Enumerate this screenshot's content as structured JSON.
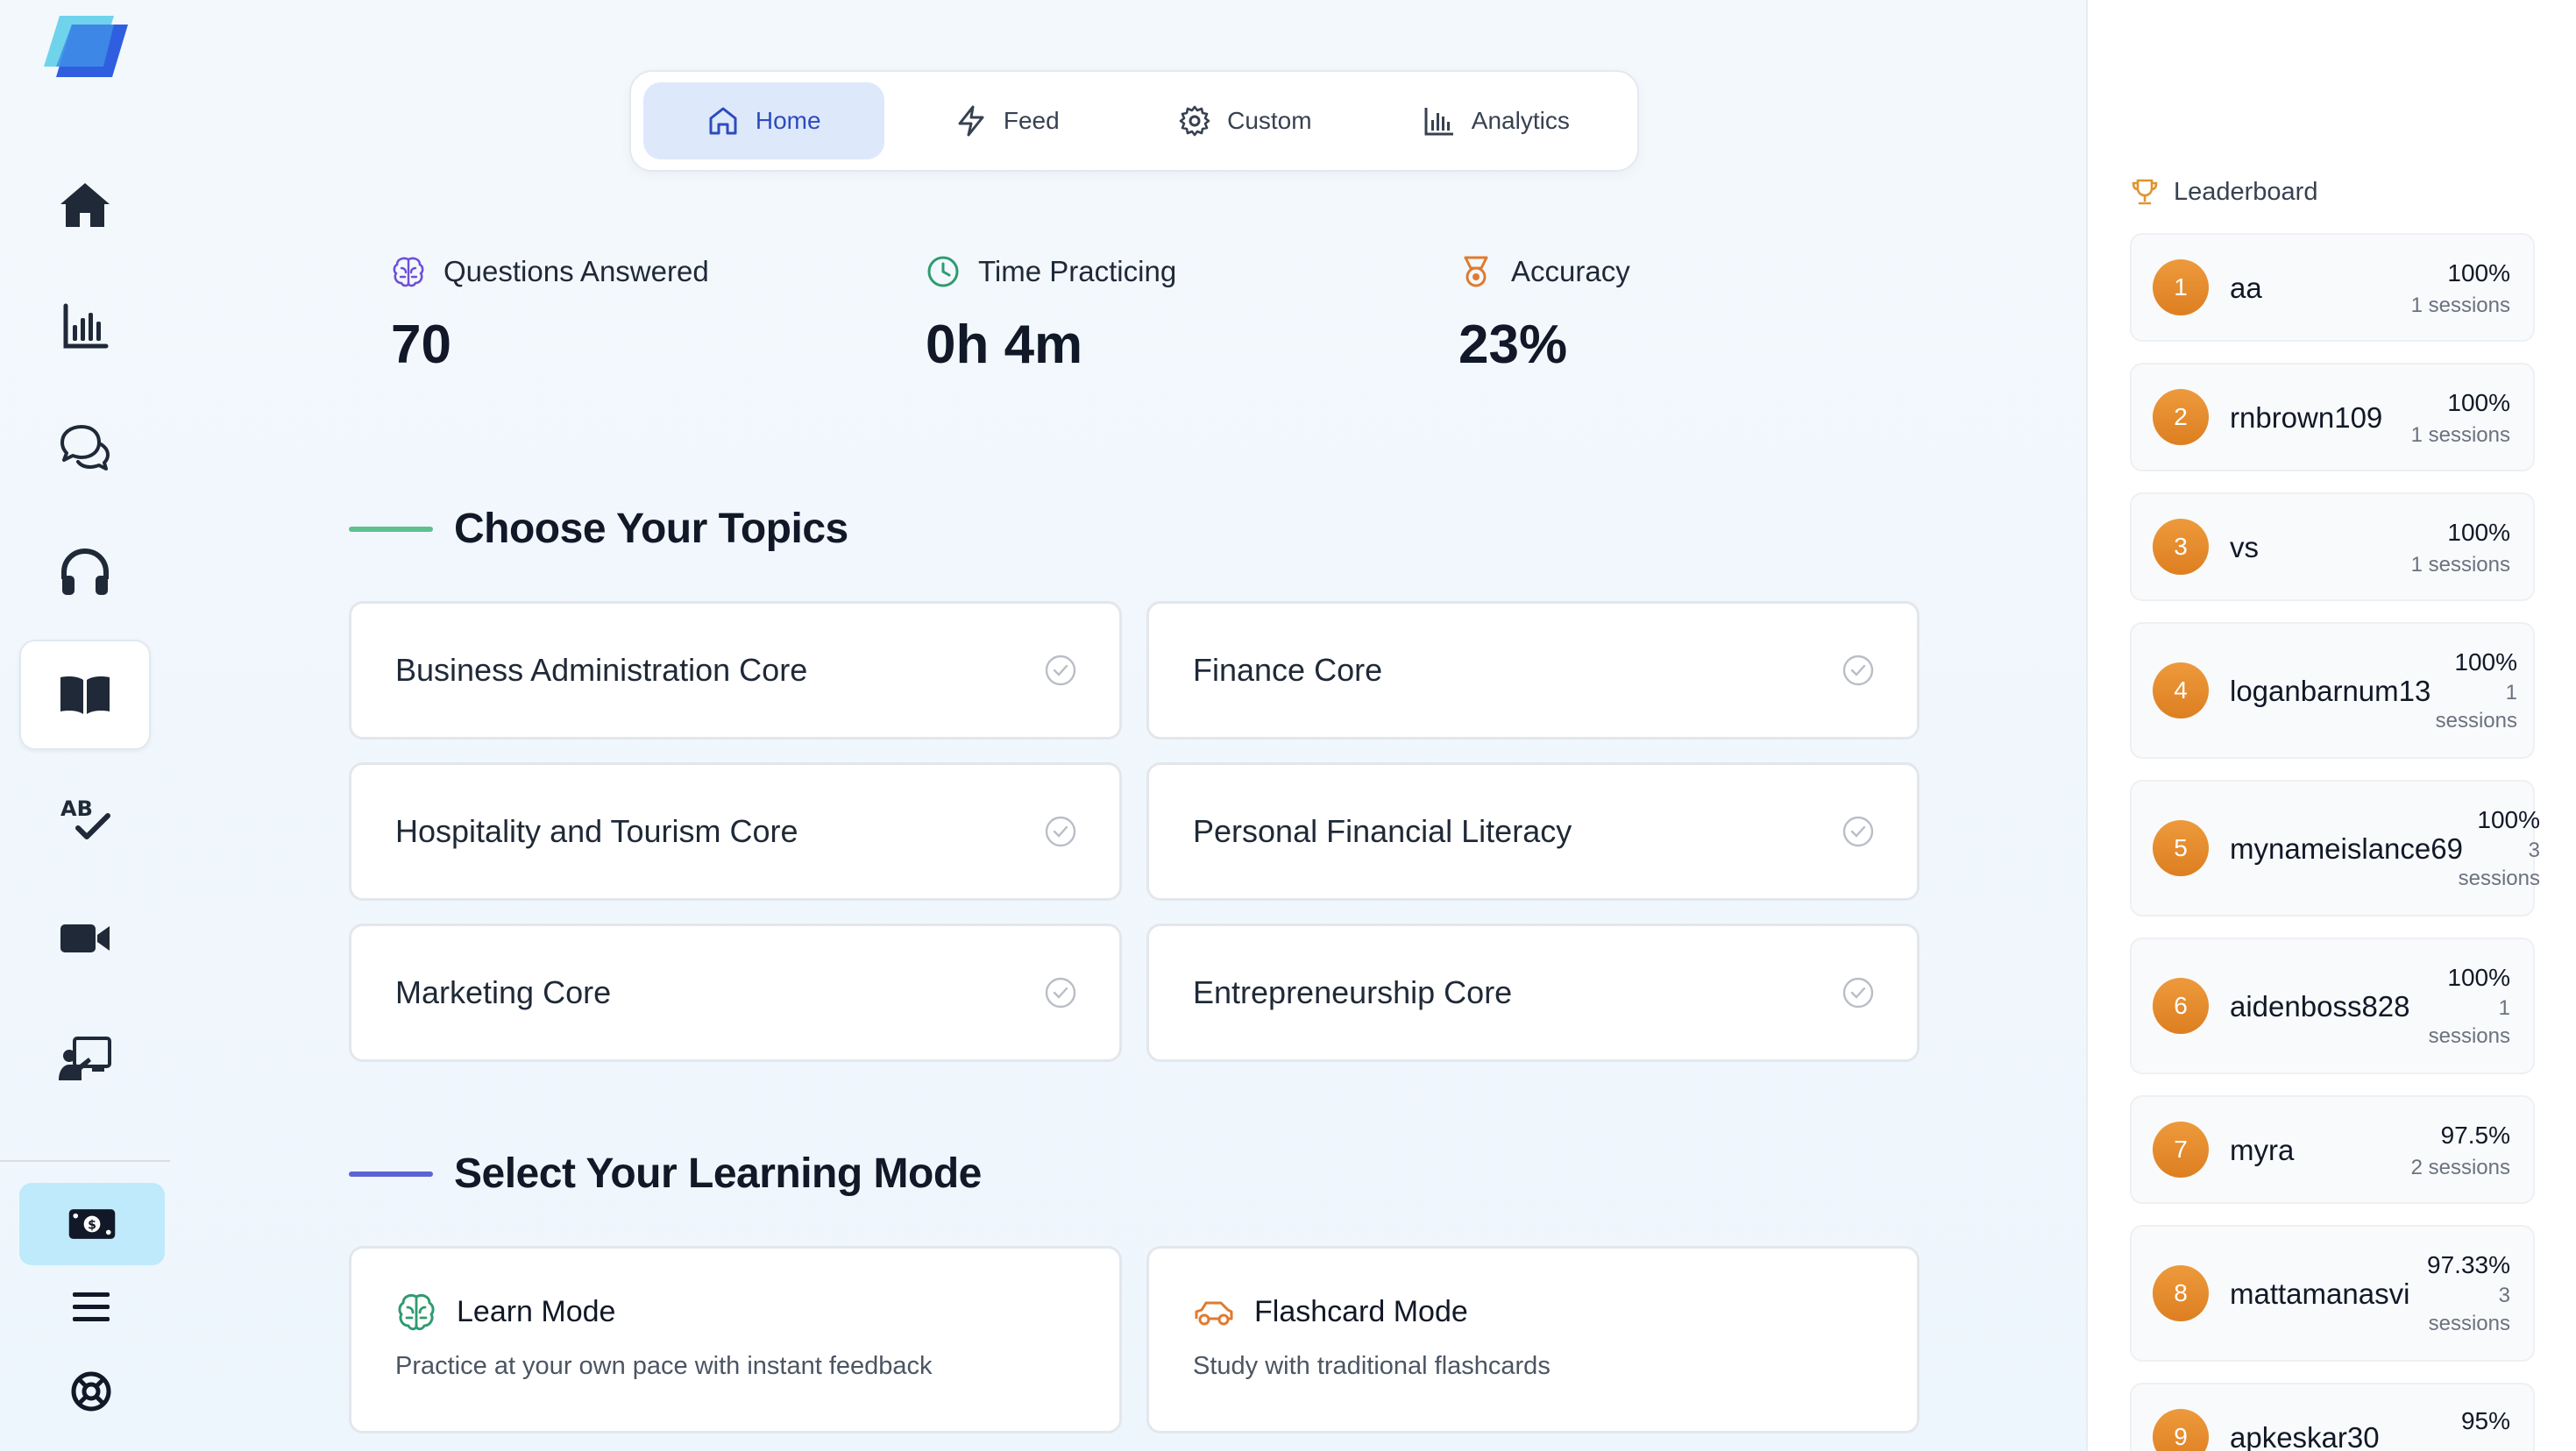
{
  "nav": {
    "tabs": [
      {
        "label": "Home",
        "icon": "home-icon",
        "active": true
      },
      {
        "label": "Feed",
        "icon": "lightning-icon",
        "active": false
      },
      {
        "label": "Custom",
        "icon": "gear-icon",
        "active": false
      },
      {
        "label": "Analytics",
        "icon": "bar-chart-icon",
        "active": false
      }
    ]
  },
  "sidebar": {
    "items": [
      {
        "icon": "home-icon",
        "active": false
      },
      {
        "icon": "bar-chart-icon",
        "active": false
      },
      {
        "icon": "chat-bubbles-icon",
        "active": false
      },
      {
        "icon": "headphones-icon",
        "active": false
      },
      {
        "icon": "open-book-icon",
        "active": true
      },
      {
        "icon": "spellcheck-icon",
        "active": false
      },
      {
        "icon": "video-camera-icon",
        "active": false
      },
      {
        "icon": "presentation-icon",
        "active": false
      }
    ],
    "bottom": [
      "money-icon",
      "menu-icon",
      "help-lifebuoy-icon"
    ]
  },
  "stats": [
    {
      "label": "Questions Answered",
      "value": "70",
      "icon": "brain-icon",
      "color": "#6d4fd6"
    },
    {
      "label": "Time Practicing",
      "value": "0h 4m",
      "icon": "clock-icon",
      "color": "#2e9b6f"
    },
    {
      "label": "Accuracy",
      "value": "23%",
      "icon": "medal-icon",
      "color": "#e07a2f"
    }
  ],
  "topics": {
    "title": "Choose Your Topics",
    "accent": "#5fc08e",
    "items": [
      "Business Administration Core",
      "Finance Core",
      "Hospitality and Tourism Core",
      "Personal Financial Literacy",
      "Marketing Core",
      "Entrepreneurship Core"
    ]
  },
  "modes": {
    "title": "Select Your Learning Mode",
    "accent": "#5b63d6",
    "items": [
      {
        "title": "Learn Mode",
        "desc": "Practice at your own pace with instant feedback",
        "icon": "brain-icon"
      },
      {
        "title": "Flashcard Mode",
        "desc": "Study with traditional flashcards",
        "icon": "car-icon"
      }
    ]
  },
  "leaderboard": {
    "title": "Leaderboard",
    "entries": [
      {
        "rank": "1",
        "name": "aa",
        "pct": "100%",
        "sessions": "1 sessions"
      },
      {
        "rank": "2",
        "name": "rnbrown109",
        "pct": "100%",
        "sessions": "1 sessions"
      },
      {
        "rank": "3",
        "name": "vs",
        "pct": "100%",
        "sessions": "1 sessions"
      },
      {
        "rank": "4",
        "name": "loganbarnum13",
        "pct": "100%",
        "sessions_count": "1",
        "sessions_word": "sessions"
      },
      {
        "rank": "5",
        "name": "mynameislance69",
        "pct": "100%",
        "sessions_count": "3",
        "sessions_word": "sessions"
      },
      {
        "rank": "6",
        "name": "aidenboss828",
        "pct": "100%",
        "sessions_count": "1",
        "sessions_word": "sessions"
      },
      {
        "rank": "7",
        "name": "myra",
        "pct": "97.5%",
        "sessions": "2 sessions"
      },
      {
        "rank": "8",
        "name": "mattamanasvi",
        "pct": "97.33%",
        "sessions_count": "3",
        "sessions_word": "sessions"
      },
      {
        "rank": "9",
        "name": "apkeskar30",
        "pct": "95%"
      }
    ]
  }
}
